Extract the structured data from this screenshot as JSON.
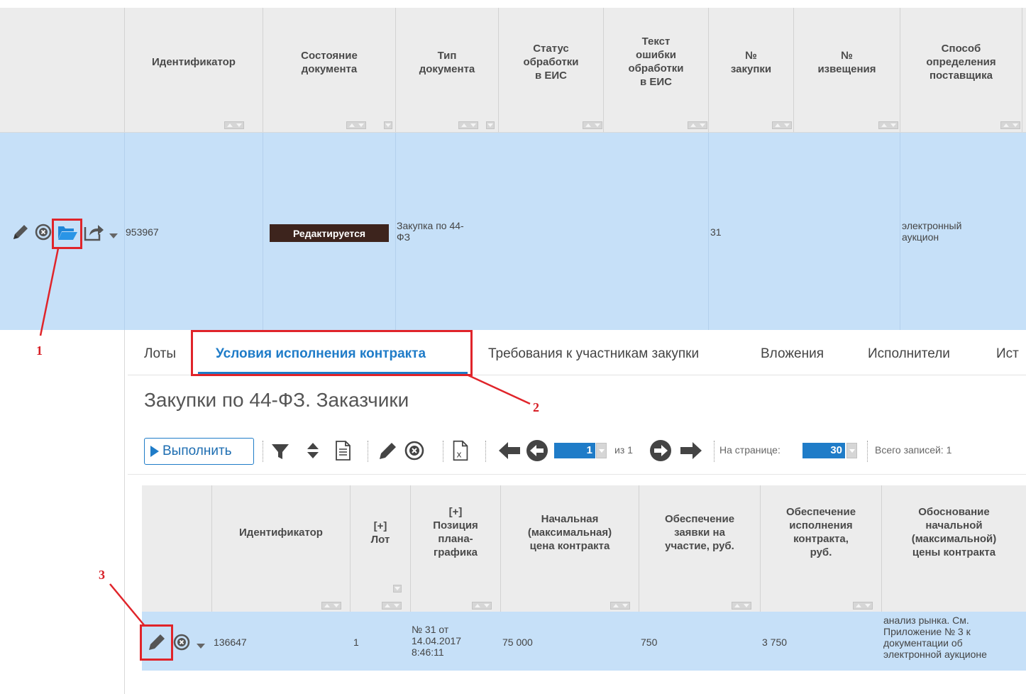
{
  "top_grid": {
    "headers": [
      {
        "key": "id",
        "label": "Идентификатор"
      },
      {
        "key": "state",
        "label": "Состояние\nдокумента"
      },
      {
        "key": "type",
        "label": "Тип\nдокумента"
      },
      {
        "key": "eis_status",
        "label": "Статус\nобработки\nв ЕИС"
      },
      {
        "key": "eis_error",
        "label": "Текст\nошибки\nобработки\nв ЕИС"
      },
      {
        "key": "purchase_no",
        "label": "№\nзакупки"
      },
      {
        "key": "notice_no",
        "label": "№\nизвещения"
      },
      {
        "key": "supplier_method",
        "label": "Способ\nопределения\nпоставщика"
      }
    ],
    "row": {
      "id": "953967",
      "state": "Редактируется",
      "type": "Закупка по 44-\nФЗ",
      "purchase_no": "31",
      "supplier_method": "электронный\nаукцион"
    }
  },
  "tabs": [
    {
      "label": "Лоты",
      "active": false
    },
    {
      "label": "Условия исполнения контракта",
      "active": true
    },
    {
      "label": "Требования к участникам закупки",
      "active": false
    },
    {
      "label": "Вложения",
      "active": false
    },
    {
      "label": "Исполнители",
      "active": false
    },
    {
      "label": "Ист",
      "active": false
    }
  ],
  "subgrid_title": "Закупки по 44-ФЗ. Заказчики",
  "toolbar": {
    "execute_label": "Выполнить",
    "page": "1",
    "of_label": "из 1",
    "per_page_label": "На странице:",
    "per_page_value": "30",
    "total_label": "Всего записей: 1"
  },
  "bottom_grid": {
    "headers": [
      {
        "key": "id",
        "label": "Идентификатор"
      },
      {
        "key": "lot",
        "label": "[+]\nЛот"
      },
      {
        "key": "plan_position",
        "label": "[+]\nПозиция\nплана-\nграфика"
      },
      {
        "key": "start_price",
        "label": "Начальная\n(максимальная)\nцена контракта"
      },
      {
        "key": "bid_security",
        "label": "Обеспечение\nзаявки на\nучастие, руб."
      },
      {
        "key": "contract_security",
        "label": "Обеспечение\nисполнения\nконтракта,\nруб."
      },
      {
        "key": "price_justification",
        "label": "Обоснование\nначальной\n(максимальной)\nцены контракта"
      }
    ],
    "row": {
      "id": "136647",
      "lot": "1",
      "plan_position": "№ 31 от\n14.04.2017\n8:46:11",
      "start_price": "75 000",
      "bid_security": "750",
      "contract_security": "3 750",
      "price_justification": "анализ рынка. См.\nПриложение № 3 к\nдокументации об\nэлектронной аукционе"
    }
  },
  "annotations": [
    "1",
    "2",
    "3"
  ],
  "colors": {
    "selected_row": "#c6e0f8",
    "header_bg": "#ececec",
    "accent": "#1f7cc8",
    "badge_bg": "#3d241d",
    "annotation_red": "#e0242a"
  }
}
